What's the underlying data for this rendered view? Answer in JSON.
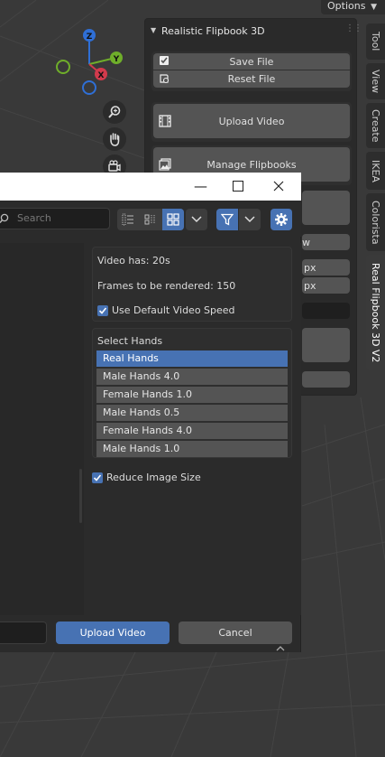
{
  "top": {
    "options_label": "Options"
  },
  "npanel": {
    "title": "Realistic Flipbook 3D",
    "save_file": "Save File",
    "reset_file": "Reset File",
    "upload_video": "Upload Video",
    "manage_flipbooks": "Manage Flipbooks",
    "partial_w": "w",
    "partial_px1": "px",
    "partial_px2": "px"
  },
  "tabs": [
    "Tool",
    "View",
    "Create",
    "IKEA",
    "Colorista",
    "Real Flipbook 3D V2"
  ],
  "dialog": {
    "search_placeholder": "Search",
    "video_has": "Video has: 20s",
    "frames": "Frames to be rendered: 150",
    "use_default_speed": "Use Default Video Speed",
    "select_hands_label": "Select Hands",
    "hands": [
      {
        "label": "Real Hands",
        "selected": true
      },
      {
        "label": "Male Hands 4.0",
        "selected": false
      },
      {
        "label": "Female Hands 1.0",
        "selected": false
      },
      {
        "label": "Male Hands 0.5",
        "selected": false
      },
      {
        "label": "Female Hands 4.0",
        "selected": false
      },
      {
        "label": "Male Hands 1.0",
        "selected": false
      }
    ],
    "reduce_image_size": "Reduce Image Size",
    "upload_button": "Upload Video",
    "cancel_button": "Cancel"
  },
  "colors": {
    "accent": "#4772b3",
    "button": "#545454",
    "panel": "#2b2b2b"
  },
  "gizmo": {
    "z": "Z",
    "y": "Y",
    "x": "X"
  }
}
